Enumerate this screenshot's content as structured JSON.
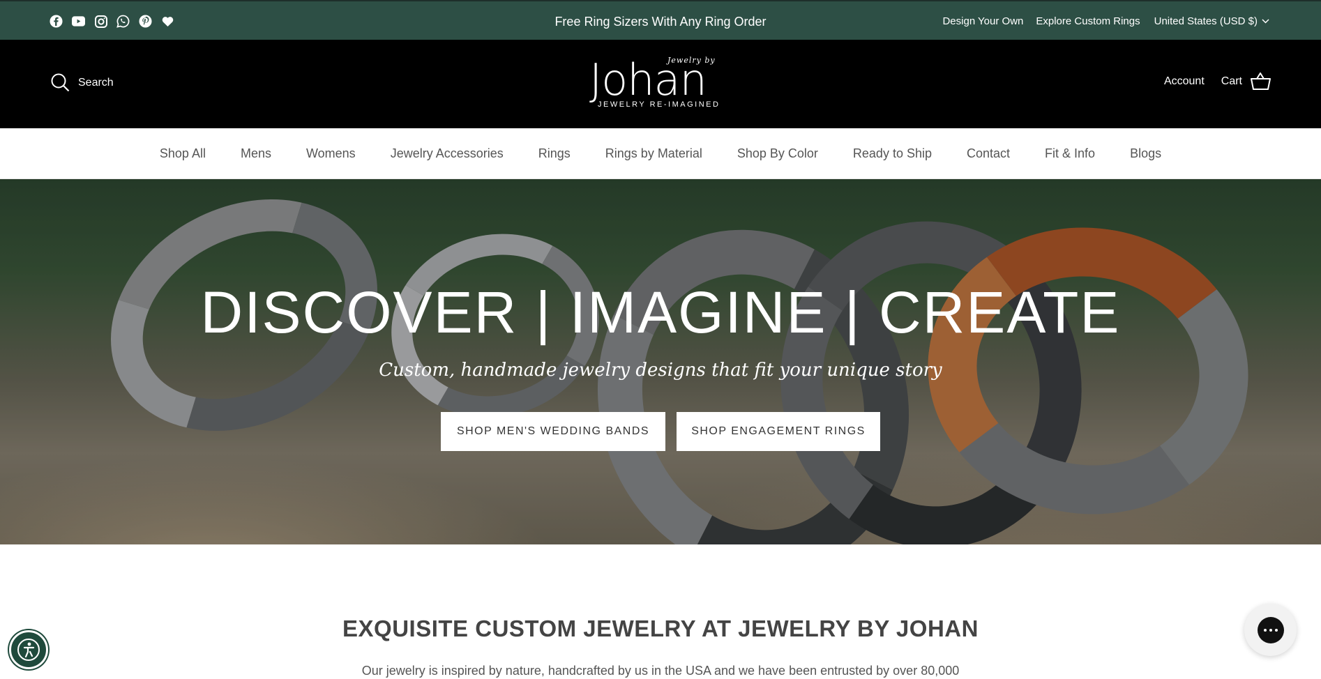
{
  "announcement": {
    "text": "Free Ring Sizers With Any Ring Order",
    "links": [
      "Design Your Own",
      "Explore Custom Rings"
    ],
    "currency": "United States (USD $)",
    "social_icons": [
      "facebook-icon",
      "youtube-icon",
      "instagram-icon",
      "whatsapp-icon",
      "pinterest-icon",
      "heart-icon"
    ]
  },
  "header": {
    "search_label": "Search",
    "logo": {
      "by": "Jewelry by",
      "name": "Johan",
      "tagline": "JEWELRY RE-IMAGINED"
    },
    "account_label": "Account",
    "cart_label": "Cart"
  },
  "nav": {
    "items": [
      "Shop All",
      "Mens",
      "Womens",
      "Jewelry Accessories",
      "Rings",
      "Rings by Material",
      "Shop By Color",
      "Ready to Ship",
      "Contact",
      "Fit & Info",
      "Blogs"
    ]
  },
  "hero": {
    "title": "DISCOVER | IMAGINE | CREATE",
    "subtitle": "Custom, handmade jewelry designs that fit your unique story",
    "button_primary": "SHOP MEN'S WEDDING BANDS",
    "button_secondary": "SHOP ENGAGEMENT RINGS"
  },
  "intro": {
    "title": "EXQUISITE CUSTOM JEWELRY AT JEWELRY BY JOHAN",
    "text": "Our jewelry is inspired by nature, handcrafted by us in the USA and we have been entrusted by over 80,000"
  },
  "colors": {
    "announcement_bg": "#2d4f45",
    "header_bg": "#000000",
    "accessibility_bg": "#1f4a3c"
  }
}
